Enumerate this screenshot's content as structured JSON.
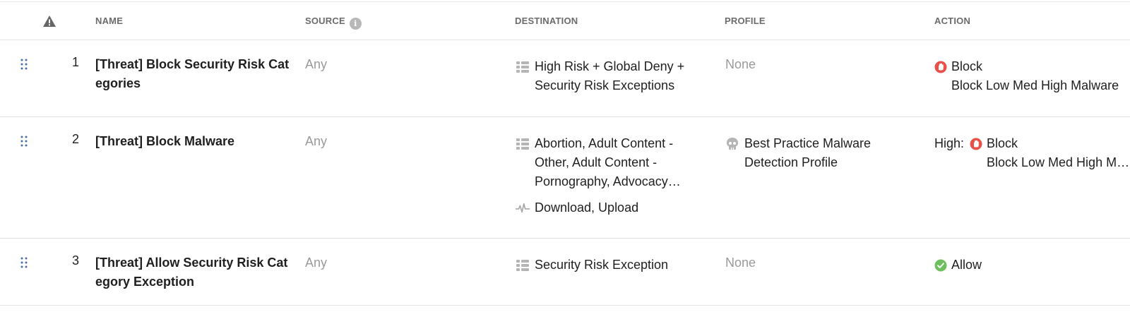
{
  "header": {
    "warning_icon": "warning-triangle-icon",
    "name": "NAME",
    "source": "SOURCE",
    "source_info_icon": "info-icon",
    "source_info_glyph": "i",
    "destination": "DESTINATION",
    "profile": "PROFILE",
    "action": "ACTION"
  },
  "rows": [
    {
      "number": "1",
      "name": "[Threat] Block Security Risk Categories",
      "source": "Any",
      "destination": "High Risk + Global Deny + Security Risk Exceptions",
      "destination_icon": "category-list-icon",
      "profile": "None",
      "action_label": "Block",
      "action_detail": "Block Low Med High Malware",
      "action_icon": "block-hand-icon"
    },
    {
      "number": "2",
      "name": "[Threat] Block Malware",
      "source": "Any",
      "destination": "Abortion, Adult Content - Other, Adult Content - Pornography, Advocacy Organizations",
      "destination_icon": "category-list-icon",
      "destination_activity": "Download, Upload",
      "destination_activity_icon": "activity-pulse-icon",
      "profile": "Best Practice Malware Detection Profile",
      "profile_icon": "skull-icon",
      "action_prefix": "High:",
      "action_label": "Block",
      "action_detail": "Block Low Med High Malware",
      "action_icon": "block-hand-icon"
    },
    {
      "number": "3",
      "name": "[Threat] Allow Security Risk Category Exception",
      "source": "Any",
      "destination": "Security Risk Exception",
      "destination_icon": "category-list-icon",
      "profile": "None",
      "action_label": "Allow",
      "action_icon": "allow-check-icon"
    }
  ],
  "colors": {
    "block": "#e8504a",
    "allow": "#6cbf5a",
    "muted_text": "#9a9a9a",
    "drag_handle": "#4a6fa5"
  }
}
